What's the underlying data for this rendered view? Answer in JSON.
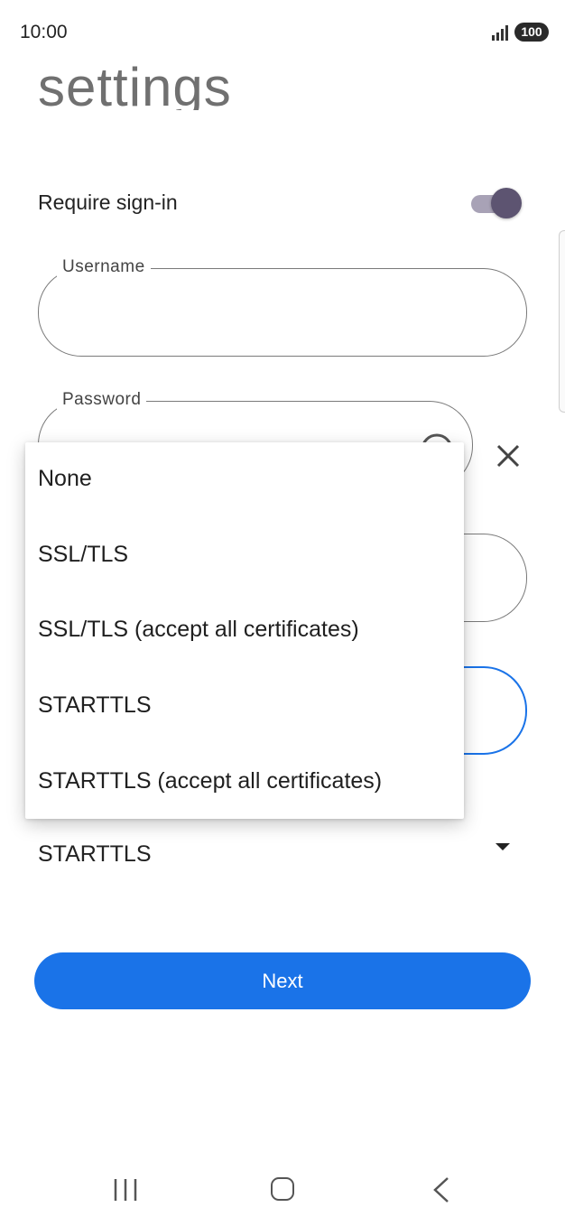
{
  "status_bar": {
    "time": "10:00",
    "battery": "100"
  },
  "page": {
    "title": "settings"
  },
  "require_signin": {
    "label": "Require sign-in",
    "enabled": true
  },
  "username_field": {
    "label": "Username",
    "value": ""
  },
  "password_field": {
    "label": "Password",
    "value": ""
  },
  "security_dropdown": {
    "selected": "STARTTLS",
    "options": [
      "None",
      "SSL/TLS",
      "SSL/TLS (accept all certificates)",
      "STARTTLS",
      "STARTTLS (accept all certificates)"
    ]
  },
  "actions": {
    "next_label": "Next"
  },
  "colors": {
    "accent": "#1a73e8",
    "toggle_thumb": "#5d5471",
    "toggle_track": "#a8a2b6"
  }
}
